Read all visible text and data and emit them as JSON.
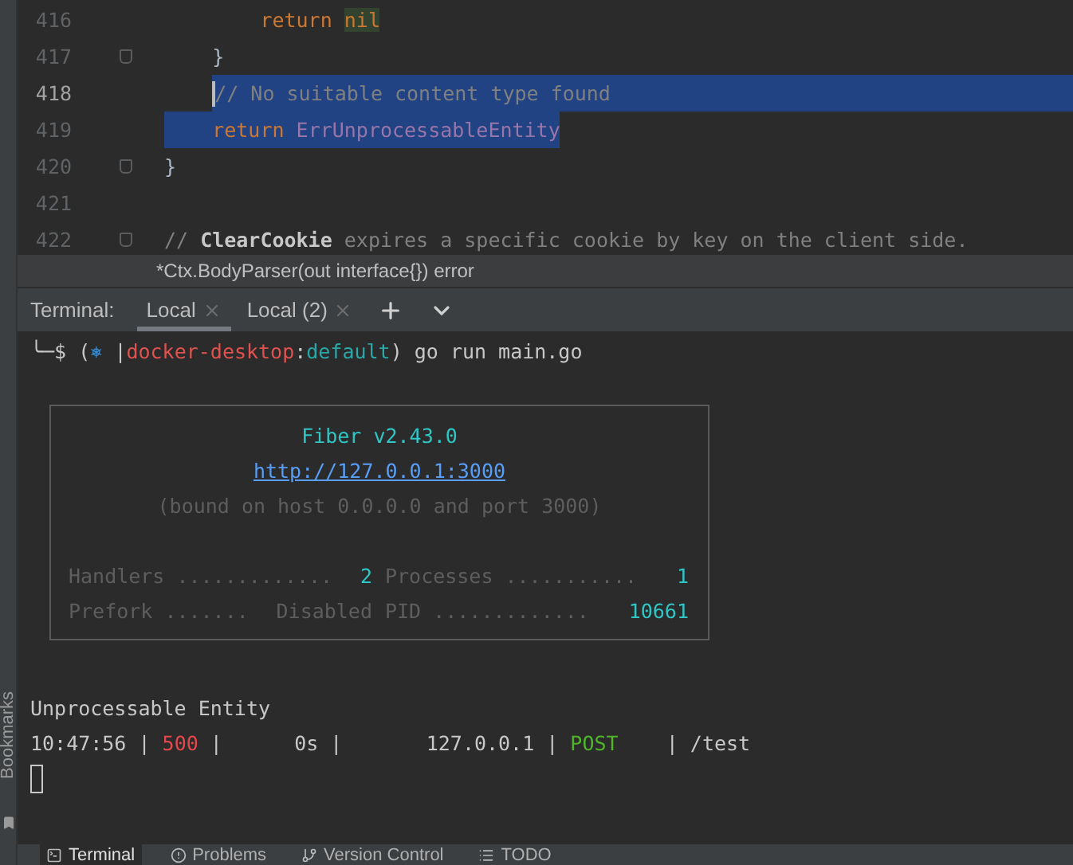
{
  "editor": {
    "lines": [
      {
        "number": "416",
        "fold": false,
        "caret": false,
        "selected": false,
        "tokens": [
          {
            "kind": "keyword",
            "text": "        return "
          },
          {
            "kind": "match",
            "text": "nil"
          }
        ]
      },
      {
        "number": "417",
        "fold": true,
        "caret": false,
        "selected": false,
        "tokens": [
          {
            "kind": "plain",
            "text": "    }"
          }
        ]
      },
      {
        "number": "418",
        "fold": false,
        "caret": true,
        "selected": true,
        "tokens": [
          {
            "kind": "comment",
            "text": "    // No suitable content type found"
          }
        ]
      },
      {
        "number": "419",
        "fold": false,
        "caret": false,
        "selected": true,
        "tokens": [
          {
            "kind": "keyword",
            "text": "    return "
          },
          {
            "kind": "const",
            "text": "ErrUnprocessableEntity"
          }
        ]
      },
      {
        "number": "420",
        "fold": true,
        "caret": false,
        "selected": false,
        "tokens": [
          {
            "kind": "plain",
            "text": "}"
          }
        ]
      },
      {
        "number": "421",
        "fold": false,
        "caret": false,
        "selected": false
      },
      {
        "number": "422",
        "fold": true,
        "caret": false,
        "selected": false,
        "tokens": [
          {
            "kind": "comment",
            "text": "// "
          },
          {
            "kind": "docref",
            "text": "ClearCookie"
          },
          {
            "kind": "comment",
            "text": " expires a specific cookie by key on the client side."
          }
        ]
      }
    ],
    "breadcrumb": "*Ctx.BodyParser(out interface{}) error"
  },
  "terminal": {
    "label": "Terminal:",
    "tabs": [
      {
        "label": "Local",
        "selected": true
      },
      {
        "label": "Local (2)",
        "selected": false
      }
    ],
    "prompt": [
      {
        "kind": "text",
        "text": "╰─$ ("
      },
      {
        "kind": "icon",
        "text": "⎈"
      },
      {
        "kind": "text",
        "text": " |"
      },
      {
        "kind": "context",
        "text": "docker-desktop"
      },
      {
        "kind": "text",
        "text": ":"
      },
      {
        "kind": "namespace",
        "text": "default"
      },
      {
        "kind": "text",
        "text": ") go run main.go"
      }
    ],
    "banner": {
      "title": "Fiber v2.43.0",
      "url": "http://127.0.0.1:3000",
      "note": "(bound on host 0.0.0.0 and port 3000)",
      "stats": [
        {
          "label": "Handlers .............",
          "value": "2",
          "color": "#2fc6c6"
        },
        {
          "label": "Processes ...........",
          "value": "1",
          "color": "#2fc6c6"
        },
        {
          "label": "Prefork .......",
          "value": "Disabled",
          "color": "#5e5e5e"
        },
        {
          "label": "PID .............",
          "value": "10661",
          "color": "#2fc6c6"
        }
      ]
    },
    "message": "Unprocessable Entity",
    "log": [
      {
        "kind": "text",
        "text": "10:47:56 | "
      },
      {
        "kind": "error",
        "text": "500"
      },
      {
        "kind": "text",
        "text": " |      0s |       127.0.0.1 | "
      },
      {
        "kind": "method",
        "text": "POST"
      },
      {
        "kind": "text",
        "text": "    | /test"
      }
    ]
  },
  "side_strip": {
    "label": "Bookmarks"
  },
  "bottom_tabs": [
    {
      "label": "Terminal",
      "selected": true
    },
    {
      "label": "Problems",
      "selected": false
    },
    {
      "label": "Version Control",
      "selected": false
    },
    {
      "label": "TODO",
      "selected": false
    }
  ]
}
